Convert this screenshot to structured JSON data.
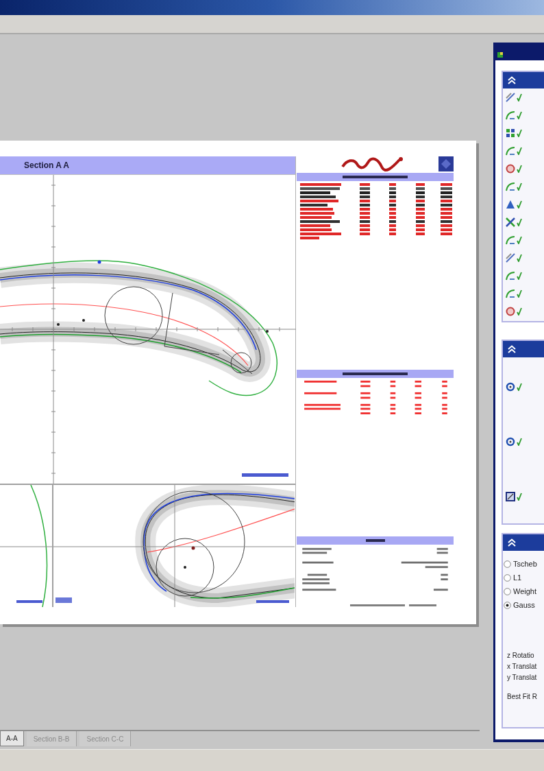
{
  "report": {
    "section_title": "Section A A",
    "attribute_rows": [
      {
        "color": "#e02828"
      },
      {
        "color": "#505050"
      },
      {
        "color": "#202020"
      },
      {
        "color": "#303030"
      },
      {
        "color": "#e02828"
      },
      {
        "color": "#303030"
      },
      {
        "color": "#e02828"
      },
      {
        "color": "#e02828"
      },
      {
        "color": "#e02828"
      },
      {
        "color": "#303030"
      },
      {
        "color": "#e02828"
      },
      {
        "color": "#e02828"
      },
      {
        "color": "#e02828"
      },
      {
        "color": "#e02828"
      }
    ]
  },
  "side_panel": {
    "feature_items": [
      {
        "kind": "slant",
        "checked": true
      },
      {
        "kind": "curve",
        "checked": true
      },
      {
        "kind": "grid",
        "checked": true
      },
      {
        "kind": "curve",
        "checked": true
      },
      {
        "kind": "circle",
        "checked": true
      },
      {
        "kind": "curve",
        "checked": true
      },
      {
        "kind": "triangle",
        "checked": true
      },
      {
        "kind": "cross",
        "checked": true
      },
      {
        "kind": "curve",
        "checked": true
      },
      {
        "kind": "slant",
        "checked": true
      },
      {
        "kind": "curve",
        "checked": true
      },
      {
        "kind": "curve",
        "checked": true
      },
      {
        "kind": "circle",
        "checked": true
      }
    ],
    "view_items": [
      {
        "kind": "ring",
        "checked": true
      },
      {
        "kind": "ring",
        "checked": true
      },
      {
        "kind": "frame",
        "checked": true
      }
    ],
    "fit_methods": [
      {
        "label": "Tscheb",
        "selected": false
      },
      {
        "label": "L1",
        "selected": false
      },
      {
        "label": "Weight",
        "selected": false
      },
      {
        "label": "Gauss",
        "selected": true
      }
    ],
    "fit_lines": [
      "z Rotatio",
      "x Translat",
      "y Translat"
    ],
    "best_fit_line": "Best Fit R"
  },
  "tabs": [
    {
      "label": "A-A",
      "selected": true
    },
    {
      "label": "Section B-B",
      "selected": false
    },
    {
      "label": "Section C-C",
      "selected": false
    }
  ]
}
